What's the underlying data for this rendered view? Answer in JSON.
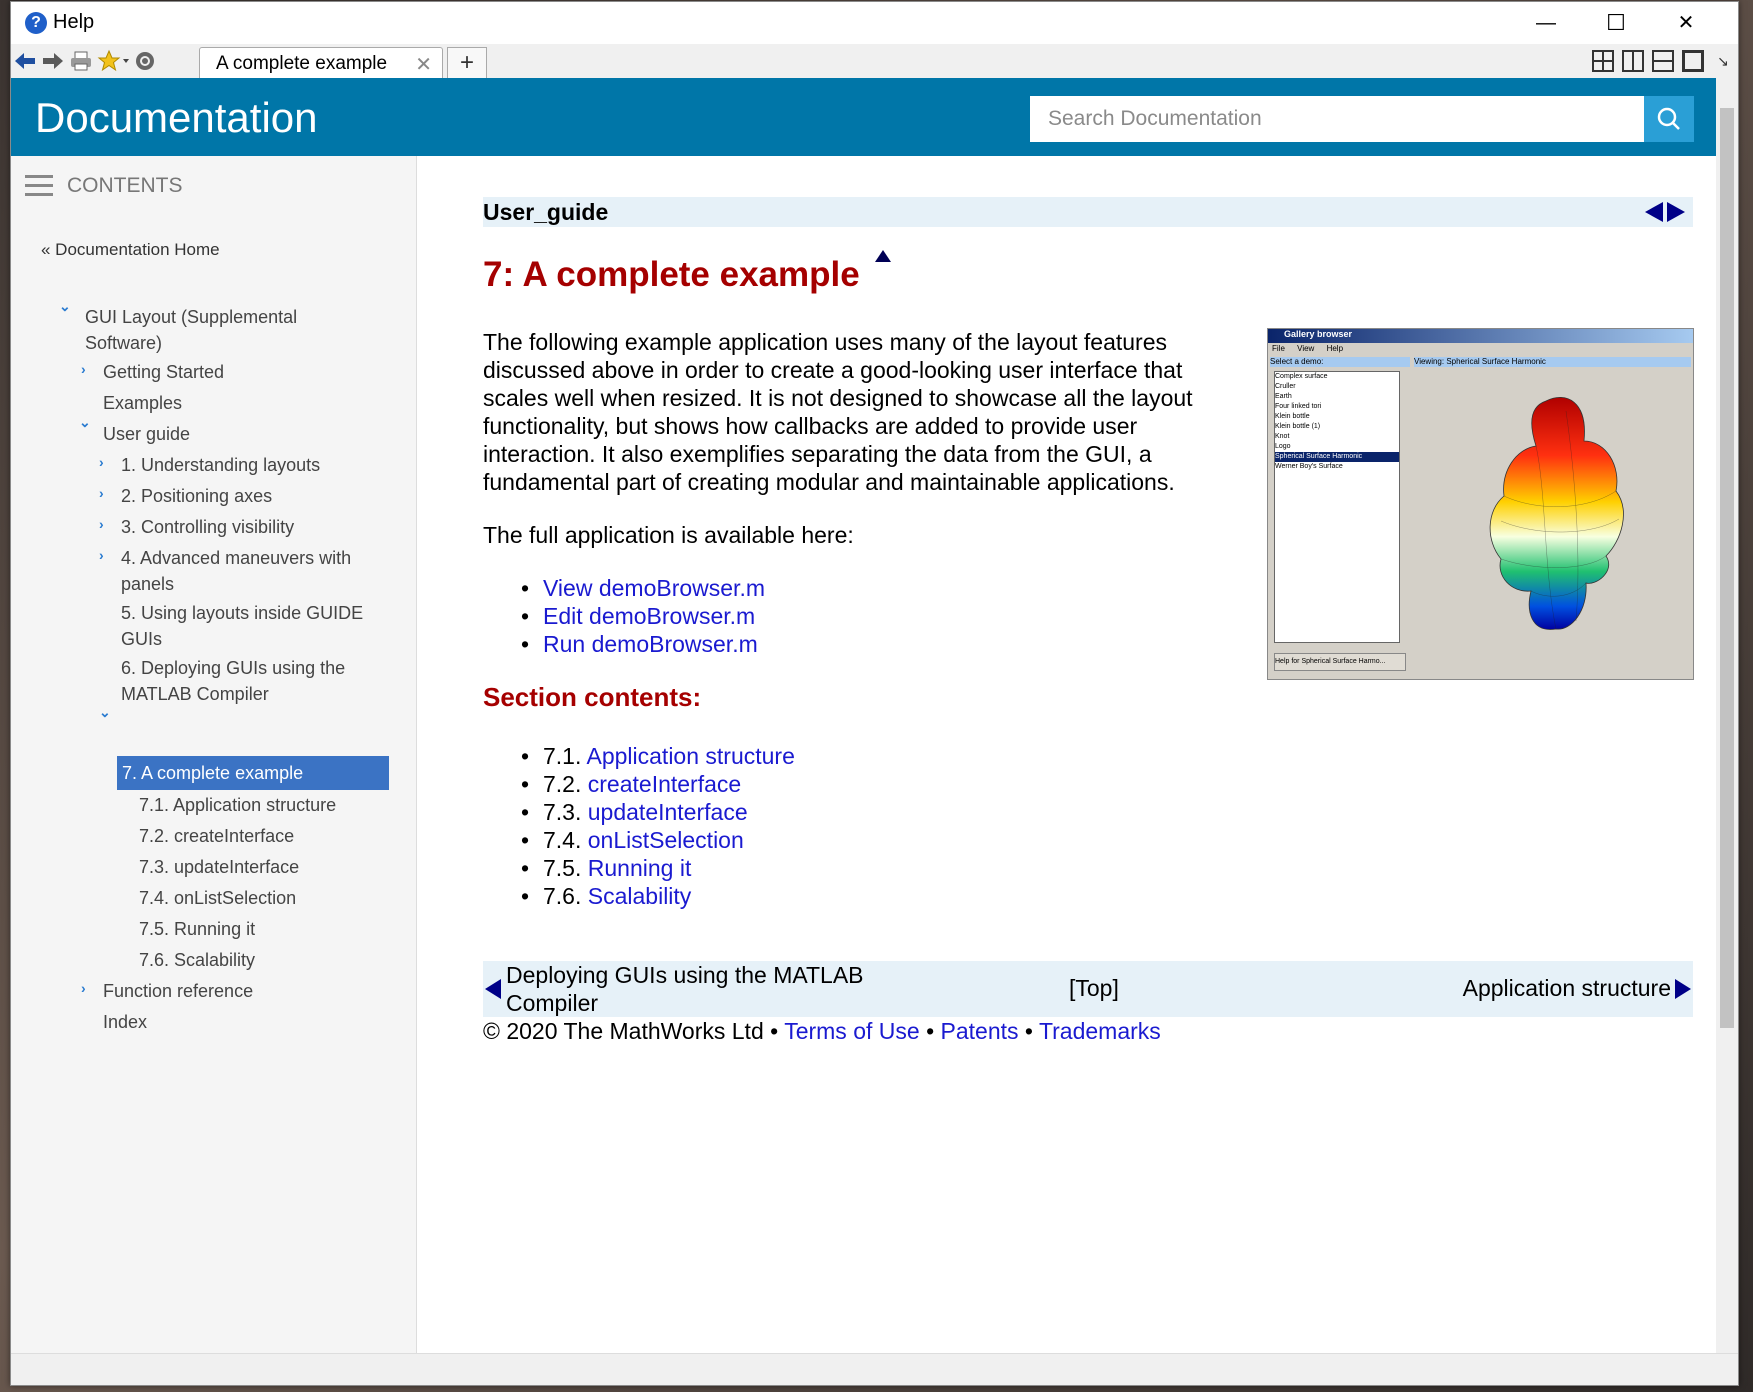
{
  "window": {
    "title": "Help",
    "controls": {
      "minimize": "—",
      "maximize": "☐",
      "close": "✕"
    }
  },
  "toolbar": {
    "tab_label": "A complete example",
    "tab_close": "✕",
    "tab_add": "+"
  },
  "header": {
    "title": "Documentation",
    "search_placeholder": "Search Documentation"
  },
  "sidebar": {
    "contents_label": "CONTENTS",
    "doc_home": "« Documentation Home",
    "items": [
      {
        "label": "GUI Layout (Supplemental",
        "label2": "Software)"
      },
      {
        "label": "Getting Started"
      },
      {
        "label": "Examples"
      },
      {
        "label": "User guide"
      },
      {
        "label": "1. Understanding layouts"
      },
      {
        "label": "2. Positioning axes"
      },
      {
        "label": "3. Controlling visibility"
      },
      {
        "label": "4. Advanced maneuvers with",
        "label2": "panels"
      },
      {
        "label": "5. Using layouts inside GUIDE",
        "label2": "GUIs"
      },
      {
        "label": "6. Deploying GUIs using the",
        "label2": "MATLAB Compiler"
      },
      {
        "label": "7. A complete example"
      },
      {
        "label": "7.1. Application structure"
      },
      {
        "label": "7.2. createInterface"
      },
      {
        "label": "7.3. updateInterface"
      },
      {
        "label": "7.4. onListSelection"
      },
      {
        "label": "7.5. Running it"
      },
      {
        "label": "7.6. Scalability"
      },
      {
        "label": "Function reference"
      },
      {
        "label": "Index"
      }
    ]
  },
  "content": {
    "breadcrumb": "User_guide",
    "title": "7: A complete example",
    "intro_lines": [
      "The following example application uses many of the layout features",
      "discussed above in order to create a good-looking user interface that",
      "scales well when resized. It is not designed to showcase all the layout",
      "functionality, but shows how callbacks are added to provide user",
      "interaction. It also exemplifies separating the data from the GUI, a",
      "fundamental part of creating modular and maintainable applications."
    ],
    "available_text": "The full application is available here:",
    "app_links": [
      "View demoBrowser.m",
      "Edit demoBrowser.m",
      "Run demoBrowser.m"
    ],
    "section_heading": "Section contents:",
    "sections": [
      {
        "num": "7.1.",
        "label": "Application structure"
      },
      {
        "num": "7.2.",
        "label": "createInterface"
      },
      {
        "num": "7.3.",
        "label": "updateInterface"
      },
      {
        "num": "7.4.",
        "label": "onListSelection"
      },
      {
        "num": "7.5.",
        "label": "Running it"
      },
      {
        "num": "7.6.",
        "label": "Scalability"
      }
    ],
    "nav_prev_line1": "Deploying GUIs using the MATLAB",
    "nav_prev_line2": "Compiler",
    "nav_top": "[Top]",
    "nav_next": "Application structure",
    "footer": {
      "copyright": "© 2020 The MathWorks Ltd",
      "sep": "•",
      "terms": "Terms of Use",
      "patents": "Patents",
      "trademarks": "Trademarks"
    }
  },
  "figure": {
    "window_title": "Gallery browser",
    "menu": [
      "File",
      "View",
      "Help"
    ],
    "list_label": "Select a demo:",
    "view_label": "Viewing: Spherical Surface Harmonic",
    "demos": [
      "Complex surface",
      "Cruller",
      "Earth",
      "Four linked tori",
      "Klein bottle",
      "Klein bottle (1)",
      "Knot",
      "Logo",
      "Spherical Surface Harmonic",
      "Werner Boy's Surface"
    ],
    "help_button": "Help for Spherical Surface Harmo..."
  },
  "colors": {
    "header_bg": "#0076a8",
    "title_red": "#a50000",
    "link_blue": "#1a1ad0",
    "active_nav": "#3b73c4"
  }
}
